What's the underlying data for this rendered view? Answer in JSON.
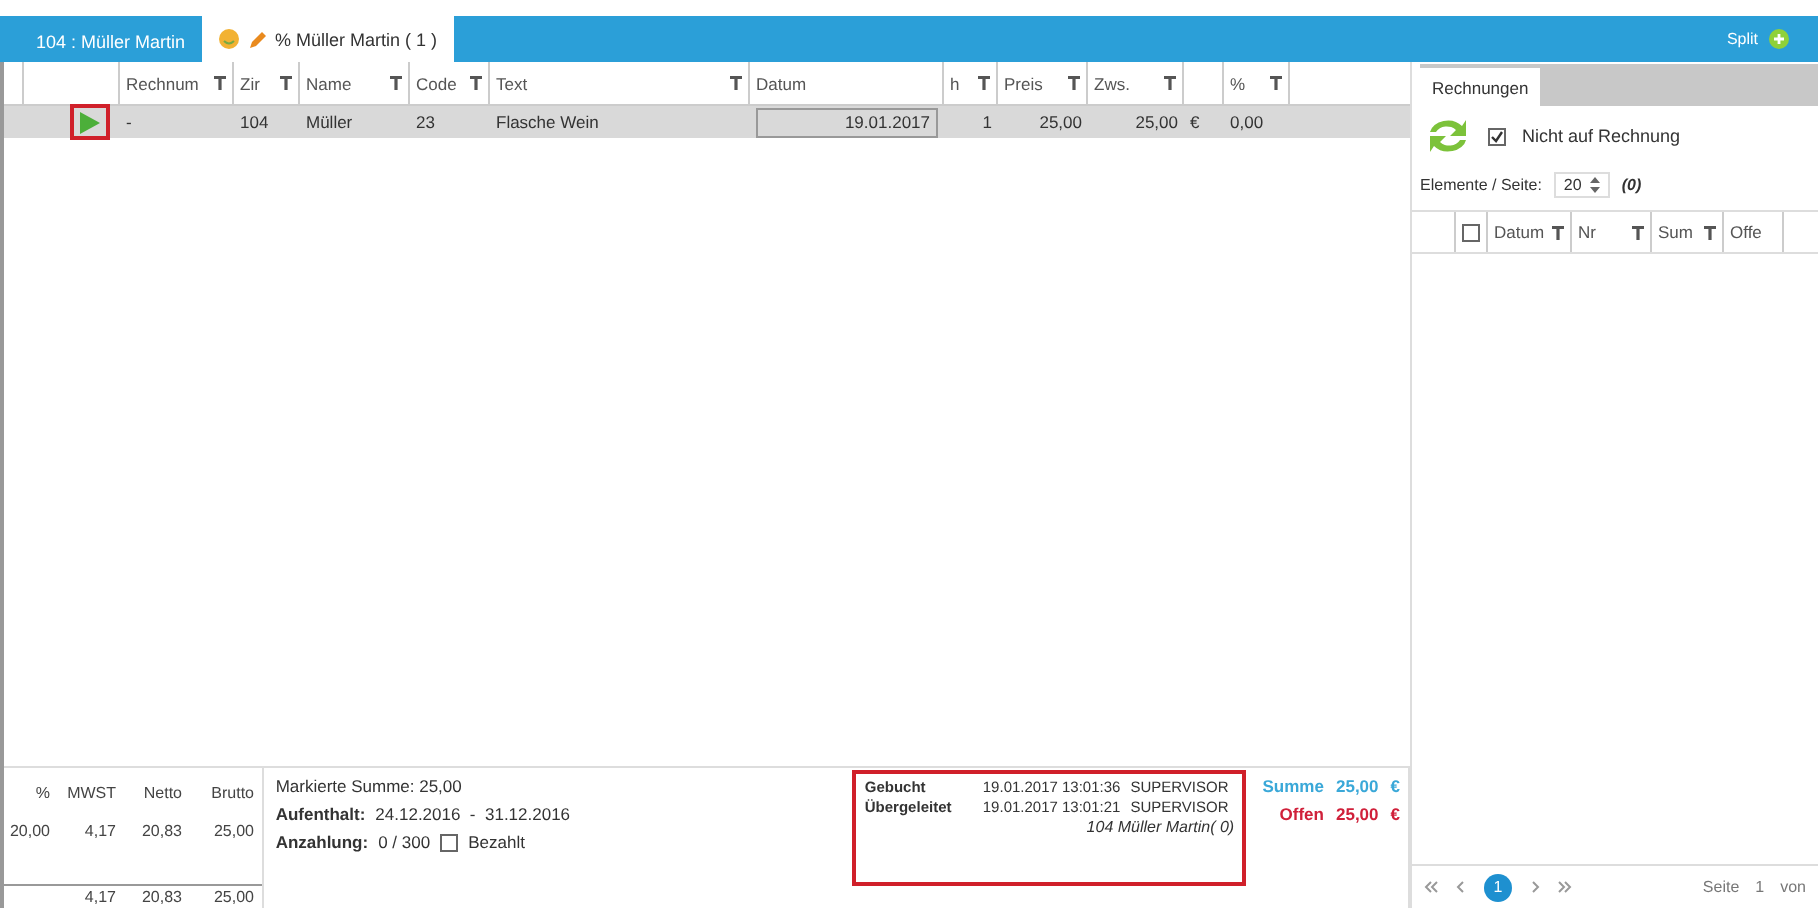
{
  "title_bar": {
    "tabs": [
      {
        "label": "104 : Müller Martin",
        "selected": false,
        "icons": false
      },
      {
        "label": "% Müller Martin ( 1 )",
        "selected": true,
        "icons": true
      }
    ],
    "split_label": "Split"
  },
  "grid": {
    "columns": [
      {
        "label": "Rechnum",
        "filter": true
      },
      {
        "label": "Zir",
        "filter": true
      },
      {
        "label": "Name",
        "filter": true
      },
      {
        "label": "Code",
        "filter": true
      },
      {
        "label": "Text",
        "filter": true
      },
      {
        "label": "Datum",
        "filter": false
      },
      {
        "label": "h",
        "filter": true
      },
      {
        "label": "Preis",
        "filter": true
      },
      {
        "label": "Zws.",
        "filter": true
      },
      {
        "filter": false
      },
      {
        "label": "%",
        "filter": true
      }
    ],
    "rows": [
      {
        "selected": true,
        "marked": true,
        "cells": [
          "-",
          "104",
          "Müller",
          "23",
          "Flasche Wein",
          "19.01.2017",
          "1",
          "25,00",
          "25,00",
          "€",
          "0,00"
        ]
      }
    ]
  },
  "tax_table": {
    "columns": [
      "%",
      "MWST",
      "Netto",
      "Brutto"
    ],
    "rows": [
      [
        "20,00",
        "4,17",
        "20,83",
        "25,00"
      ]
    ],
    "totals": [
      "4,17",
      "20,83",
      "25,00"
    ]
  },
  "info": {
    "marked_sum": "Markierte Summe: 25,00",
    "stay_label": "Aufenthalt:",
    "stay_value": "24.12.2016  -  31.12.2016",
    "deposit_label": "Anzahlung:",
    "deposit_value": "0 / 300",
    "paid": {
      "label": "Bezahlt",
      "checked": false
    }
  },
  "booking": {
    "marked": true,
    "entries": [
      {
        "label": "Gebucht",
        "timestamp": "19.01.2017 13:01:36",
        "user": "SUPERVISOR"
      },
      {
        "label": "Übergeleitet",
        "timestamp": "19.01.2017 13:01:21",
        "user": "SUPERVISOR"
      }
    ],
    "note": "104 Müller Martin( 0)"
  },
  "sums": [
    {
      "label": "Summe",
      "value": "25,00",
      "currency": "€",
      "color": "#3aa8d8"
    },
    {
      "label": "Offen",
      "value": "25,00",
      "currency": "€",
      "color": "#d0203a"
    }
  ],
  "invoices_panel": {
    "tab": {
      "label": "Rechnungen",
      "selected": true
    },
    "not_on_invoice": {
      "label": "Nicht auf Rechnung",
      "checked": true
    },
    "per_page_label": "Elemente / Seite:",
    "per_page": "20",
    "count": "(0)",
    "select_all": {
      "checked": false
    },
    "columns": [
      {
        "label": "Datum",
        "filter": true
      },
      {
        "label": "Nr",
        "filter": true
      },
      {
        "label": "Sum",
        "filter": true
      },
      {
        "label": "Offe",
        "filter": false
      }
    ],
    "pager": {
      "current": "1",
      "page_label": "Seite",
      "page": "1",
      "of_label": "von"
    }
  }
}
